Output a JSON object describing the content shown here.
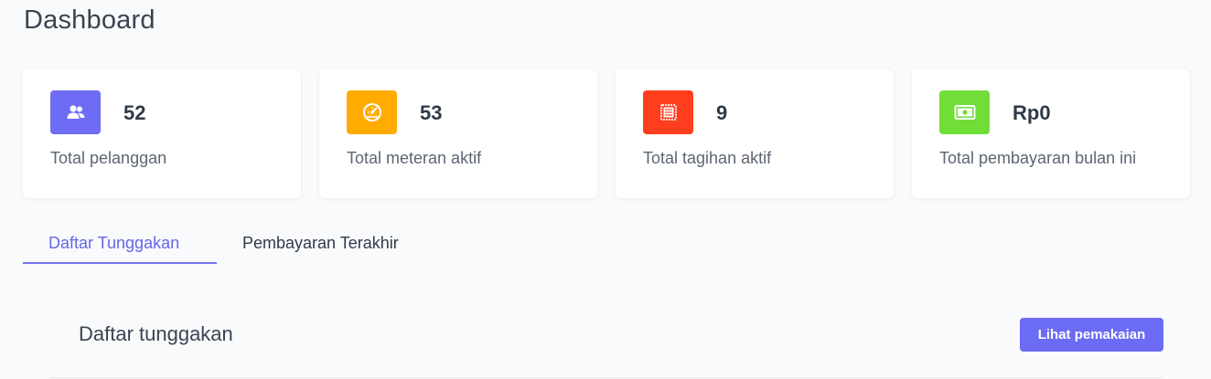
{
  "header": {
    "title": "Dashboard"
  },
  "stats": [
    {
      "value": "52",
      "label": "Total pelanggan",
      "icon": "users-icon",
      "color": "#6e6cf4"
    },
    {
      "value": "53",
      "label": "Total meteran aktif",
      "icon": "gauge-icon",
      "color": "#ffab00"
    },
    {
      "value": "9",
      "label": "Total tagihan aktif",
      "icon": "receipt-icon",
      "color": "#ff3e1d"
    },
    {
      "value": "Rp0",
      "label": "Total pembayaran bulan ini",
      "icon": "money-icon",
      "color": "#71dd37"
    }
  ],
  "tabs": [
    {
      "label": "Daftar Tunggakan",
      "active": true
    },
    {
      "label": "Pembayaran Terakhir",
      "active": false
    }
  ],
  "panel": {
    "title": "Daftar tunggakan",
    "action_label": "Lihat pemakaian"
  },
  "colors": {
    "accent": "#6c6bf3",
    "text": "#3a4451"
  }
}
